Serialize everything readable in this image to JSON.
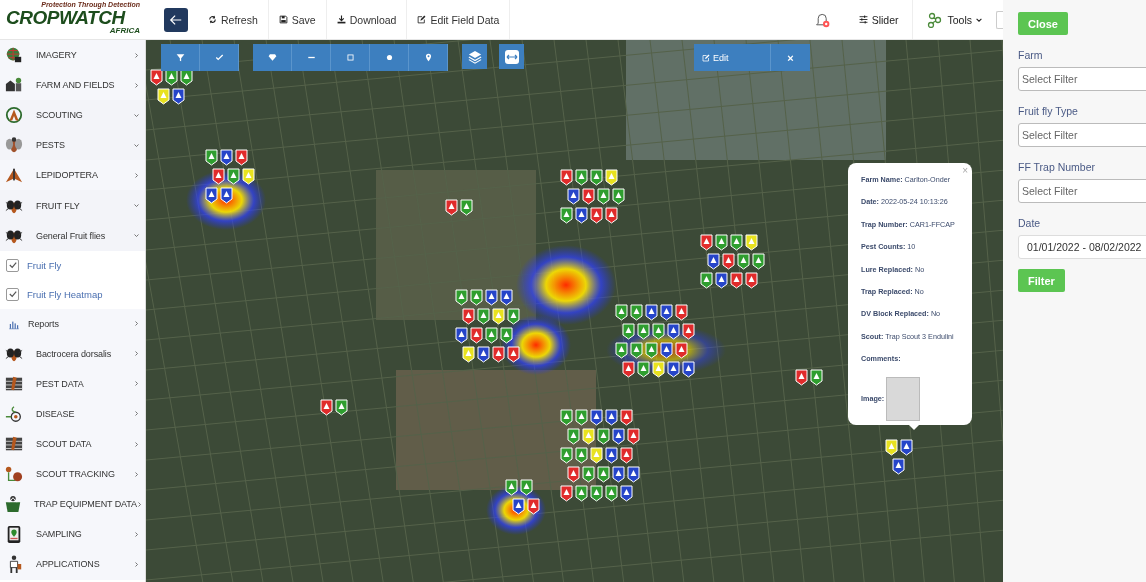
{
  "logo": {
    "name": "CROPWATCH",
    "region": "AFRICA",
    "tagline": "Protection Through Detection"
  },
  "toolbar": {
    "buttons": [
      {
        "label": "Refresh"
      },
      {
        "label": "Save"
      },
      {
        "label": "Download"
      },
      {
        "label": "Edit Field Data"
      }
    ],
    "slider": "Slider",
    "tools": "Tools"
  },
  "sidebar": {
    "items": [
      {
        "kind": "item",
        "label": "IMAGERY",
        "expanded": false
      },
      {
        "kind": "item",
        "label": "FARM AND FIELDS",
        "expanded": false
      },
      {
        "kind": "item",
        "label": "SCOUTING",
        "expanded": true
      },
      {
        "kind": "item",
        "label": "PESTS",
        "expanded": true
      },
      {
        "kind": "item",
        "label": "LEPIDOPTERA",
        "expanded": false
      },
      {
        "kind": "item",
        "label": "FRUIT FLY",
        "expanded": true
      },
      {
        "kind": "item",
        "label": "General Fruit flies",
        "expanded": true
      },
      {
        "kind": "check",
        "label": "Fruit Fly",
        "checked": true
      },
      {
        "kind": "check",
        "label": "Fruit Fly Heatmap",
        "checked": true
      },
      {
        "kind": "item",
        "label": "Reports",
        "expanded": false
      },
      {
        "kind": "item",
        "label": "Bactrocera dorsalis",
        "expanded": false
      },
      {
        "kind": "item",
        "label": "PEST DATA",
        "expanded": false
      },
      {
        "kind": "item",
        "label": "DISEASE",
        "expanded": false
      },
      {
        "kind": "item",
        "label": "SCOUT DATA",
        "expanded": false
      },
      {
        "kind": "item",
        "label": "SCOUT TRACKING",
        "expanded": false
      },
      {
        "kind": "item",
        "label": "TRAP EQUIPMENT DATA",
        "expanded": false
      },
      {
        "kind": "item",
        "label": "SAMPLING",
        "expanded": false
      },
      {
        "kind": "item",
        "label": "APPLICATIONS",
        "expanded": false
      }
    ]
  },
  "map": {
    "edit_panel": {
      "edit": "Edit",
      "close": "×"
    },
    "popup": {
      "close": "×",
      "fields": [
        {
          "label": "Farm Name:",
          "value": "Carlton-Onder"
        },
        {
          "label": "Date:",
          "value": "2022-05-24 10:13:26"
        },
        {
          "label": "Trap Number:",
          "value": "CAR1-FFCAP"
        },
        {
          "label": "Pest Counts:",
          "value": "10"
        },
        {
          "label": "Lure Replaced:",
          "value": "No"
        },
        {
          "label": "Trap Replaced:",
          "value": "No"
        },
        {
          "label": "DV Block Replaced:",
          "value": "No"
        },
        {
          "label": "Scout:",
          "value": "Trap Scout 3 Endulini"
        },
        {
          "label": "Comments:"
        }
      ],
      "image_label": "Image:"
    }
  },
  "filter_panel": {
    "close": "Close",
    "fields": [
      {
        "label": "Farm",
        "placeholder": "Select Filter"
      },
      {
        "label": "Fruit fly Type",
        "placeholder": "Select Filter"
      },
      {
        "label": "FF Trap Number",
        "placeholder": "Select Filter"
      },
      {
        "label": "Date",
        "value": "01/01/2022 - 08/02/2022"
      }
    ],
    "submit": "Filter"
  }
}
